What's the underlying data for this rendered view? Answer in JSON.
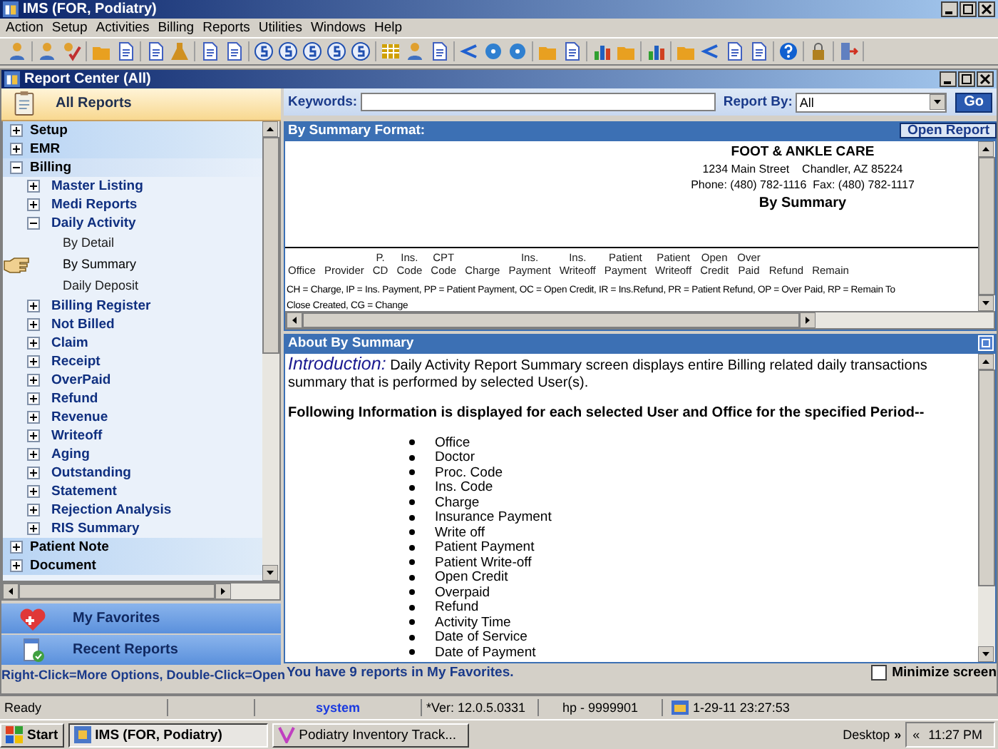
{
  "app_window": {
    "title": "IMS (FOR, Podiatry)"
  },
  "menu": [
    "Action",
    "Setup",
    "Activities",
    "Billing",
    "Reports",
    "Utilities",
    "Windows",
    "Help"
  ],
  "report_window": {
    "title": "Report Center (All)"
  },
  "sidebar": {
    "header": "All Reports",
    "tree": [
      {
        "label": "Setup",
        "kind": "section",
        "expanded": false
      },
      {
        "label": "EMR",
        "kind": "section",
        "expanded": false
      },
      {
        "label": "Billing",
        "kind": "section",
        "expanded": true,
        "children": [
          {
            "label": "Master Listing",
            "kind": "group",
            "expanded": false
          },
          {
            "label": "Medi Reports",
            "kind": "group",
            "expanded": false
          },
          {
            "label": "Daily Activity",
            "kind": "group",
            "expanded": true,
            "children": [
              {
                "label": "By Detail",
                "kind": "leaf",
                "selected": false
              },
              {
                "label": "By Summary",
                "kind": "leaf",
                "selected": true
              },
              {
                "label": "Daily Deposit",
                "kind": "leaf",
                "selected": false
              }
            ]
          },
          {
            "label": "Billing Register",
            "kind": "group",
            "expanded": false
          },
          {
            "label": "Not Billed",
            "kind": "group",
            "expanded": false
          },
          {
            "label": "Claim",
            "kind": "group",
            "expanded": false
          },
          {
            "label": "Receipt",
            "kind": "group",
            "expanded": false
          },
          {
            "label": "OverPaid",
            "kind": "group",
            "expanded": false
          },
          {
            "label": "Refund",
            "kind": "group",
            "expanded": false
          },
          {
            "label": "Revenue",
            "kind": "group",
            "expanded": false
          },
          {
            "label": "Writeoff",
            "kind": "group",
            "expanded": false
          },
          {
            "label": "Aging",
            "kind": "group",
            "expanded": false
          },
          {
            "label": "Outstanding",
            "kind": "group",
            "expanded": false
          },
          {
            "label": "Statement",
            "kind": "group",
            "expanded": false
          },
          {
            "label": "Rejection Analysis",
            "kind": "group",
            "expanded": false
          },
          {
            "label": "RIS Summary",
            "kind": "group",
            "expanded": false
          }
        ]
      },
      {
        "label": "Patient Note",
        "kind": "section",
        "expanded": false
      },
      {
        "label": "Document",
        "kind": "section",
        "expanded": false
      }
    ],
    "shortcuts": [
      {
        "label": "My Favorites",
        "kind": "favorites"
      },
      {
        "label": "Recent Reports",
        "kind": "recent"
      }
    ],
    "hint": "Right-Click=More Options, Double-Click=Open"
  },
  "search": {
    "label": "Keywords:",
    "report_by_label": "Report By:",
    "report_by_value": "All",
    "go_button": "Go"
  },
  "preview": {
    "title": "By Summary Format:",
    "open_button": "Open Report",
    "company": "FOOT & ANKLE CARE",
    "address": "1234 Main Street    Chandler, AZ 85224",
    "phone": "Phone: (480) 782-1116  Fax: (480) 782-1117",
    "report_title": "By Summary",
    "columns": [
      {
        "lines": [
          "Office"
        ]
      },
      {
        "lines": [
          "Provider"
        ]
      },
      {
        "lines": [
          "P.",
          "CD"
        ]
      },
      {
        "lines": [
          "Ins.",
          "Code"
        ]
      },
      {
        "lines": [
          "CPT",
          "Code"
        ]
      },
      {
        "lines": [
          "Charge"
        ]
      },
      {
        "lines": [
          "Ins.",
          "Payment"
        ]
      },
      {
        "lines": [
          "Ins.",
          "Writeoff"
        ]
      },
      {
        "lines": [
          "Patient",
          "Payment"
        ]
      },
      {
        "lines": [
          "Patient",
          "Writeoff"
        ]
      },
      {
        "lines": [
          "Open",
          "Credit"
        ]
      },
      {
        "lines": [
          "Over",
          "Paid"
        ]
      },
      {
        "lines": [
          "Refund"
        ]
      },
      {
        "lines": [
          "Remain"
        ]
      }
    ],
    "legend": [
      "CH = Charge, IP = Ins. Payment, PP = Patient Payment, OC = Open Credit, IR = Ins.Refund, PR = Patient Refund, OP = Over Paid, RP = Remain To",
      "Close Created, CG = Change"
    ]
  },
  "about": {
    "title": "About By Summary",
    "intro_label": "Introduction:",
    "intro_text": "Daily Activity Report Summary screen displays entire Billing related daily transactions summary that is performed by selected User(s).",
    "heading": "Following Information is displayed for each selected User and Office for the specified Period--",
    "items": [
      "Office",
      "Doctor",
      "Proc. Code",
      "Ins. Code",
      "Charge",
      "Insurance Payment",
      "Write off",
      "Patient Payment",
      "Patient Write-off",
      "Open Credit",
      "Overpaid",
      "Refund",
      "Activity Time",
      "Date of Service",
      "Date of Payment"
    ]
  },
  "favorites_message": "You have 9 reports in My Favorites.",
  "minimize_screen": {
    "label": "Minimize screen",
    "checked": false
  },
  "status_bar": {
    "message": "Ready",
    "user": "system",
    "version": "*Ver: 12.0.5.0331",
    "host": "hp - 9999901",
    "datetime": "1-29-11 23:27:53"
  },
  "taskbar": {
    "start": "Start",
    "tasks": [
      {
        "label": "IMS (FOR, Podiatry)",
        "selected": true
      },
      {
        "label": "Podiatry Inventory Track...",
        "selected": false
      }
    ],
    "desktop": "Desktop",
    "chevron": "»",
    "collapse": "«",
    "clock": "11:27 PM"
  }
}
